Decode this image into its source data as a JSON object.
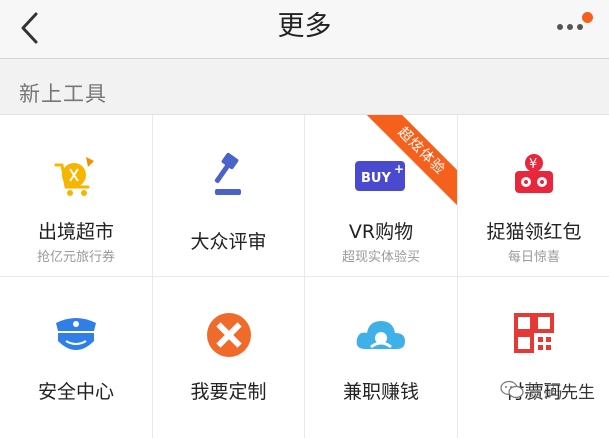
{
  "nav": {
    "title": "更多",
    "back_icon": "chevron-left-icon",
    "more_icon": "more-dots-icon"
  },
  "section": {
    "title": "新上工具"
  },
  "tools": [
    {
      "name": "出境超市",
      "sub": "抢亿元旅行券",
      "icon": "shopping-cart-icon",
      "color": "#f7b500"
    },
    {
      "name": "大众评审",
      "sub": "",
      "icon": "gavel-icon",
      "color": "#4a63c9"
    },
    {
      "name": "VR购物",
      "sub": "超现实体验买",
      "icon": "vr-buy-icon",
      "color": "#4a4ad0",
      "ribbon": "超炫体验"
    },
    {
      "name": "捉猫领红包",
      "sub": "每日惊喜",
      "icon": "red-envelope-icon",
      "color": "#e8273c"
    },
    {
      "name": "安全中心",
      "sub": "",
      "icon": "police-shield-icon",
      "color": "#2f7fe6"
    },
    {
      "name": "我要定制",
      "sub": "",
      "icon": "pencil-ruler-icon",
      "color": "#f06a2a"
    },
    {
      "name": "兼职赚钱",
      "sub": "",
      "icon": "cloud-icon",
      "color": "#3fb1e8"
    },
    {
      "name": "付款码",
      "sub": "",
      "icon": "qr-code-icon",
      "color": "#e53935"
    }
  ],
  "watermark": {
    "text": "贾珂先生",
    "icon": "wechat-icon"
  }
}
